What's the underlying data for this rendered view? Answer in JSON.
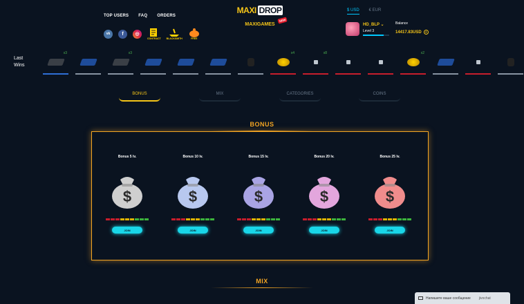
{
  "nav": {
    "top_users": "TOP USERS",
    "faq": "FAQ",
    "orders": "ORDERS"
  },
  "social": {
    "vk": "vk",
    "fb": "f",
    "ig": "◎",
    "contract": "CONTRACT",
    "blacksmith": "BLACKSMITH",
    "free": "FREE"
  },
  "logo": {
    "part1": "MAXI",
    "part2": "DROP",
    "sub": "MAXIGAMES",
    "badge": "NEW"
  },
  "currency": {
    "usd": "$ USD",
    "eur": "€ EUR"
  },
  "profile": {
    "name": "HD_BLP ⌄",
    "level": "Level 3",
    "level_progress": 0.8
  },
  "balance": {
    "label": "Balance",
    "amount": "14417.83USD",
    "plus": "+"
  },
  "lastwins": {
    "label_line1": "Last",
    "label_line2": "Wins",
    "items": [
      {
        "type": "gray",
        "mult": "x3",
        "line": "#2f6fd6"
      },
      {
        "type": "blue",
        "mult": "",
        "line": "#8894a2"
      },
      {
        "type": "gray",
        "mult": "x3",
        "line": "#8894a2"
      },
      {
        "type": "blue",
        "mult": "",
        "line": "#8894a2"
      },
      {
        "type": "blue",
        "mult": "",
        "line": "#8894a2"
      },
      {
        "type": "blue",
        "mult": "",
        "line": "#8894a2"
      },
      {
        "type": "dark",
        "mult": "",
        "line": "#8894a2"
      },
      {
        "type": "gold",
        "mult": "x4",
        "line": "#c81e2c"
      },
      {
        "type": "img",
        "mult": "x8",
        "line": "#c81e2c"
      },
      {
        "type": "img",
        "mult": "",
        "line": "#c81e2c"
      },
      {
        "type": "img",
        "mult": "",
        "line": "#c81e2c"
      },
      {
        "type": "gold",
        "mult": "x2",
        "line": "#c81e2c"
      },
      {
        "type": "blue",
        "mult": "",
        "line": "#8894a2"
      },
      {
        "type": "img",
        "mult": "",
        "line": "#c81e2c"
      },
      {
        "type": "dark",
        "mult": "",
        "line": "#8894a2"
      }
    ]
  },
  "tabs": [
    {
      "label": "BONUS",
      "active": true
    },
    {
      "label": "MIX",
      "active": false
    },
    {
      "label": "CATEGORIES",
      "active": false
    },
    {
      "label": "COINS",
      "active": false
    }
  ],
  "sections": {
    "bonus": "BONUS",
    "mix": "MIX"
  },
  "cases": [
    {
      "title": "Bonus 5 lv.",
      "color": "#cfcfcf",
      "join": "JOIN"
    },
    {
      "title": "Bonus 10 lv.",
      "color": "#b8c8ef",
      "join": "JOIN"
    },
    {
      "title": "Bonus 15 lv.",
      "color": "#a9a4e4",
      "join": "JOIN"
    },
    {
      "title": "Bonus 20 lv.",
      "color": "#e3a6dd",
      "join": "JOIN"
    },
    {
      "title": "Bonus 25 lv.",
      "color": "#f08c8c",
      "join": "JOIN"
    }
  ],
  "chat": {
    "text": "Напишите ваше сообщение",
    "brand": "jivochat"
  },
  "colors": {
    "accent": "#f5a623",
    "cyan": "#19d6e8",
    "bg": "#0a1320"
  }
}
